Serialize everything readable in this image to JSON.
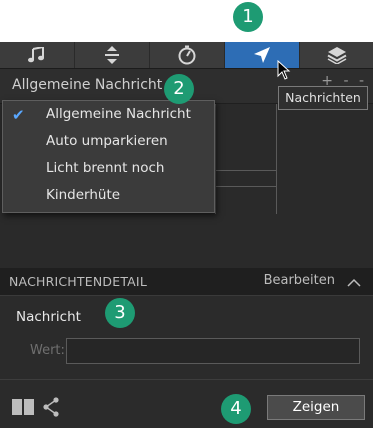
{
  "toolbar": {
    "tabs": [
      {
        "icon": "music-note-icon"
      },
      {
        "icon": "vertical-arrows-icon"
      },
      {
        "icon": "timer-icon"
      },
      {
        "icon": "navigation-arrow-icon",
        "active": true
      },
      {
        "icon": "layers-icon"
      }
    ],
    "active_color": "#2d6db5"
  },
  "header": {
    "selected_message": "Allgemeine Nachricht",
    "chevron": "⌵",
    "right_controls": "+ - -"
  },
  "dropdown": {
    "items": [
      {
        "label": "Allgemeine Nachricht",
        "checked": true
      },
      {
        "label": "Auto umparkieren",
        "checked": false
      },
      {
        "label": "Licht brennt noch",
        "checked": false
      },
      {
        "label": "Kinderhüte",
        "checked": false
      }
    ],
    "check_glyph": "✔"
  },
  "tooltip": {
    "text": "Nachrichten"
  },
  "section": {
    "title": "NACHRICHTENDETAIL",
    "edit_label": "Bearbeiten"
  },
  "detail": {
    "title": "Nachricht",
    "wert_label": "Wert:",
    "wert_value": ""
  },
  "footer": {
    "show_button": "Zeigen"
  },
  "badges": [
    "1",
    "2",
    "3",
    "4"
  ],
  "colors": {
    "badge": "#1e9b73",
    "accent": "#2d6db5",
    "check": "#5aa8ff"
  }
}
